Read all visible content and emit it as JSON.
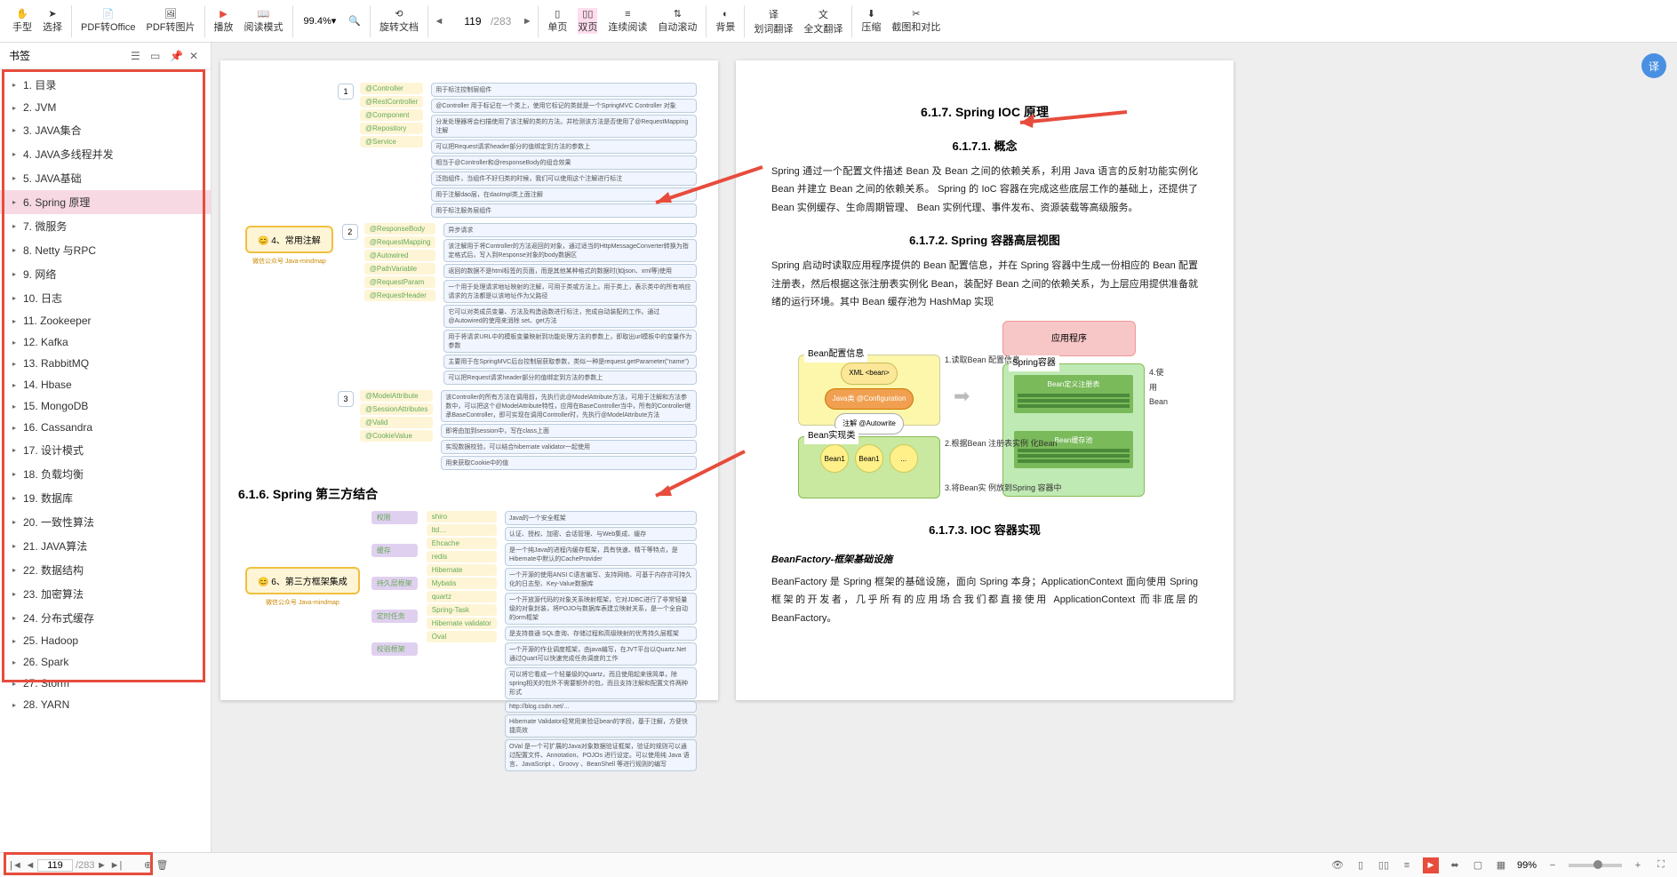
{
  "toolbar": {
    "hand": "手型",
    "select": "选择",
    "pdf_office": "PDF转Office",
    "pdf_image": "PDF转图片",
    "play": "播放",
    "read_mode": "阅读模式",
    "rotate": "旋转文档",
    "single": "单页",
    "double": "双页",
    "cont": "连续阅读",
    "auto_scroll": "自动滚动",
    "bg": "背景",
    "word_trans": "划词翻译",
    "full_trans": "全文翻译",
    "compress": "压缩",
    "crop": "截图和对比",
    "zoom": "99.4%",
    "page_current": "119",
    "page_total": "/283"
  },
  "sidebar": {
    "title": "书签",
    "items": [
      "1.  目录",
      "2.  JVM",
      "3.  JAVA集合",
      "4.  JAVA多线程并发",
      "5.  JAVA基础",
      "6.  Spring 原理",
      "7.   微服务",
      "8.  Netty 与RPC",
      "9.  网络",
      "10.  日志",
      "11.  Zookeeper",
      "12.  Kafka",
      "13.  RabbitMQ",
      "14.  Hbase",
      "15.  MongoDB",
      "16.  Cassandra",
      "17.  设计模式",
      "18.  负载均衡",
      "19.  数据库",
      "20.  一致性算法",
      "21.  JAVA算法",
      "22.  数据结构",
      "23.  加密算法",
      "24.  分布式缓存",
      "25.  Hadoop",
      "26.  Spark",
      "27.  Storm",
      "28.  YARN"
    ],
    "active_index": 5
  },
  "doc": {
    "left": {
      "mm1_root": "😊 4、常用注解",
      "mm1_sub": "微信公众号 Java-mindmap",
      "mm1_nodes": [
        "@Controller",
        "@RestController",
        "@Component",
        "@Repository",
        "@Service",
        "@ResponseBody",
        "@RequestMapping",
        "@Autowired",
        "@PathVariable",
        "@RequestParam",
        "@RequestHeader",
        "@ModelAttribute",
        "@SessionAttributes",
        "@Valid",
        "@CookieValue"
      ],
      "mm1_hints": [
        "用于标注控制层组件",
        "@Controller 用于标记在一个类上，使用它标记的类就是一个SpringMVC Controller 对象",
        "分发处理器将会扫描使用了该注解的类的方法。并检测该方法是否使用了@RequestMapping 注解",
        "可以把Request请求header部分的值绑定到方法的参数上",
        "相当于@Controller和@responseBody的组合效果",
        "泛指组件，当组件不好归类的时候，我们可以使用这个注解进行标注",
        "用于注解dao层，在daoImpl类上面注解",
        "用于标注服务层组件",
        "异步请求",
        "该注解用于将Controller的方法返回的对象，通过适当的HttpMessageConverter转换为指定格式后，写入到Response对象的body数据区",
        "返回的数据不是html标签的页面，而是其他某种格式的数据时(如json、xml等)使用",
        "一个用于处理请求地址映射的注解，可用于类或方法上。用于类上，表示类中的所有响应请求的方法都是以该地址作为父路径",
        "它可以对类成员变量、方法及构造函数进行标注，完成自动装配的工作。通过 @Autowired的使用来消除 set、get方法",
        "用于将请求URL中的模板变量映射到功能处理方法的参数上，即取出url模板中的变量作为参数",
        "主要用于在SpringMVC后台控制层获取参数，类似一种是request.getParameter(\"name\")",
        "可以把Request请求header部分的值绑定到方法的参数上",
        "该Controller的所有方法在调用前，先执行此@ModelAttribute方法，可用于注解和方法参数中，可以把这个@ModelAttribute特性，应用在BaseController当中，所有的Controller继承BaseController，即可实现在调用Controller时，先执行@ModelAttribute方法",
        "即将由加到session中，写在class上面",
        "实现数据校验，可以结合hibernate validator一起使用",
        "用来获取Cookie中的值"
      ],
      "section_616": "6.1.6.  Spring 第三方结合",
      "mm2_root": "😊 6、第三方框架集成",
      "mm2_sub": "微信公众号 Java-mindmap",
      "mm2_groups": [
        "权限",
        "缓存",
        "持久层框架",
        "定时任务",
        "校验框架"
      ],
      "mm2_nodes": [
        "shiro",
        "ltd…",
        "Ehcache",
        "redis",
        "Hibernate",
        "Mybatis",
        "quartz",
        "Spring-Task",
        "Hibernate validator",
        "Oval"
      ],
      "mm2_hints": [
        "Java的一个安全框架",
        "认证、授权、加密、会话管理、与Web集成、缓存",
        "是一个纯Java的进程内缓存框架，具有快速、精干等特点，是Hibernate中默认的CacheProvider",
        "一个开源的使用ANSI C语言编写、支持网络、可基于内存亦可持久化的日志型、Key-Value数据库",
        "一个开放源代码的对象关系映射框架，它对JDBC进行了非常轻量级的对象封装，将POJO与数据库表建立映射关系，是一个全自动的orm框架",
        "是支持普通 SQL查询、存储过程和高级映射的优秀持久层框架",
        "一个开源的作业调度框架，由java编写，在JVT平台以Quartz.Net通过Quart可以快速完成任务调度的工作",
        "可以将它看成一个轻量级的Quartz，而且使用起来很简单，除spring相关的包外不需要额外的包，而且支持注解和配置文件两种形式",
        "http://blog.csdn.net/…",
        "Hibernate Validator经常用来验证bean的字段，基于注解，方便快捷高效",
        "OVal 是一个可扩展的Java对象数据验证框架，验证的规则可以通过配置文件、Annotation、POJOs 进行设定。可以使用纯 Java 语言、JavaScript 、Groovy 、BeanShell 等进行规则的编写"
      ]
    },
    "right": {
      "h617": "6.1.7.  Spring IOC 原理",
      "h6171": "6.1.7.1.     概念",
      "p6171": "Spring 通过一个配置文件描述 Bean 及 Bean 之间的依赖关系，利用 Java 语言的反射功能实例化 Bean 并建立 Bean 之间的依赖关系。 Spring 的 IoC 容器在完成这些底层工作的基础上，还提供了 Bean 实例缓存、生命周期管理、 Bean 实例代理、事件发布、资源装载等高级服务。",
      "h6172": "6.1.7.2.     Spring 容器高层视图",
      "p6172": "Spring 启动时读取应用程序提供的 Bean 配置信息，并在 Spring 容器中生成一份相应的 Bean 配置注册表，然后根据这张注册表实例化 Bean，装配好 Bean 之间的依赖关系，为上层应用提供准备就绪的运行环境。其中 Bean 缓存池为 HashMap 实现",
      "diagram": {
        "app": "应用程序",
        "cfg": "Bean配置信息",
        "xml": "XML <bean>",
        "java": "Java类 @Configuration",
        "ann": "注解 @Autowrite",
        "impl": "Bean实现类",
        "beans": [
          "Bean1",
          "Bean1",
          "..."
        ],
        "spring": "Spring容器",
        "reg": "Bean定义注册表",
        "pool": "Bean缓存池",
        "l1": "1.读取Bean 配置信息",
        "l2": "2.根据Bean 注册表实例 化Bean",
        "l3": "3.将Bean实 例放到Spring 容器中",
        "l4": "4.使用Bean"
      },
      "h6173": "6.1.7.3.     IOC 容器实现",
      "bf_title": "BeanFactory-框架基础设施",
      "p6173": "BeanFactory 是 Spring 框架的基础设施，面向 Spring 本身；ApplicationContext 面向使用 Spring 框架的开发者，几乎所有的应用场合我们都直接使用 ApplicationContext 而非底层的 BeanFactory。"
    }
  },
  "statusbar": {
    "page_current": "119",
    "page_total": "/283",
    "zoom": "99%"
  }
}
